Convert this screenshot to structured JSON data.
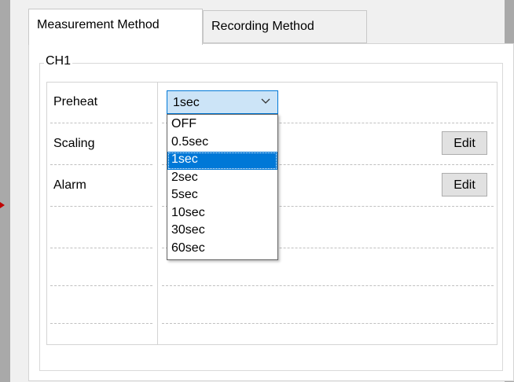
{
  "tabs": [
    {
      "label": "Measurement Method",
      "active": true
    },
    {
      "label": "Recording Method",
      "active": false
    }
  ],
  "group": {
    "title": "CH1",
    "rows": [
      {
        "label": "Preheat"
      },
      {
        "label": "Scaling"
      },
      {
        "label": "Alarm"
      }
    ],
    "preheat_select": {
      "value": "1sec",
      "options": [
        "OFF",
        "0.5sec",
        "1sec",
        "2sec",
        "5sec",
        "10sec",
        "30sec",
        "60sec"
      ],
      "highlighted": "1sec"
    },
    "scaling_edit_label": "Edit",
    "alarm_edit_label": "Edit"
  },
  "colors": {
    "accent": "#0078d7",
    "select_bg": "#cce4f7",
    "window_bg": "#f0f0f0",
    "outer_bg": "#a9a9a9"
  },
  "icons": {
    "select": "chevron-down-icon",
    "pointer": "arrow-marker-icon"
  }
}
